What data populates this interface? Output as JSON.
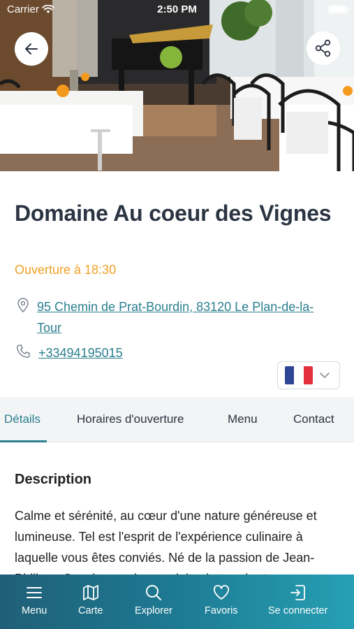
{
  "status_bar": {
    "carrier": "Carrier",
    "time": "2:50 PM"
  },
  "hero": {
    "back_icon": "arrow-left-icon",
    "share_icon": "share-icon"
  },
  "venue": {
    "name": "Domaine Au coeur des Vignes",
    "opening": "Ouverture à 18:30",
    "address": "95 Chemin de Prat-Bourdin, 83120 Le Plan-de-la-Tour",
    "phone": "+33494195015"
  },
  "language": {
    "selected": "fr",
    "flag_colors": [
      "#2e4594",
      "#ffffff",
      "#e3303b"
    ]
  },
  "tabs": [
    {
      "label": "Détails",
      "active": true
    },
    {
      "label": "Horaires d'ouverture",
      "active": false
    },
    {
      "label": "Menu",
      "active": false
    },
    {
      "label": "Contact",
      "active": false
    }
  ],
  "description": {
    "title": "Description",
    "text": "Calme et sérénité, au cœur d'une nature généreuse et lumineuse. Tel est l'esprit de l'expérience culinaire à laquelle vous êtes conviés. Né de la passion de Jean-Philippe Cousin pour les produits du terroir et"
  },
  "bottom_nav": [
    {
      "label": "Menu",
      "icon": "menu-icon"
    },
    {
      "label": "Carte",
      "icon": "map-icon"
    },
    {
      "label": "Explorer",
      "icon": "search-icon"
    },
    {
      "label": "Favoris",
      "icon": "heart-icon"
    },
    {
      "label": "Se connecter",
      "icon": "login-icon"
    }
  ],
  "colors": {
    "accent": "#2a7f8e",
    "opening": "#f0a126",
    "nav_gradient": [
      "#1f5f77",
      "#26a0b4"
    ]
  }
}
